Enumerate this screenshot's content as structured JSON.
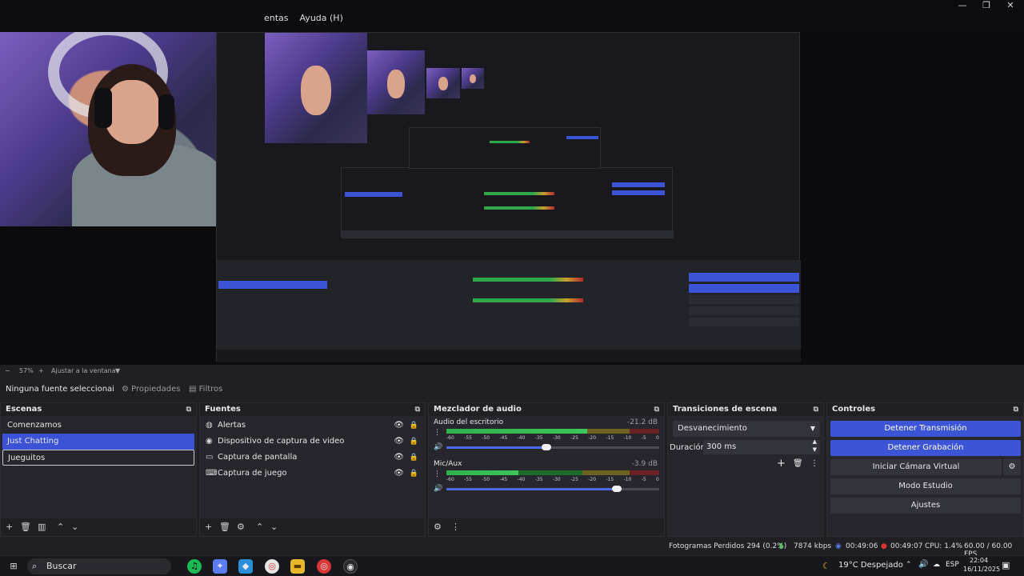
{
  "menu": {
    "items": [
      "entas",
      "Ayuda (H)"
    ]
  },
  "window": {
    "minimize": "—",
    "restore": "❐",
    "close": "✕"
  },
  "zoom": {
    "minus": "−",
    "percent": "57%",
    "plus": "+",
    "fit": "Ajustar a la ventana",
    "fit_arrow": "▼"
  },
  "source_toolbar": {
    "no_source": "Ninguna fuente seleccionai",
    "properties": "Propiedades",
    "filters": "Filtros"
  },
  "scenes": {
    "title": "Escenas",
    "items": [
      "Comenzamos",
      "Just Chatting",
      "Jueguitos"
    ],
    "selected": "Just Chatting"
  },
  "sources": {
    "title": "Fuentes",
    "items": [
      {
        "label": "Alertas",
        "icon": "globe-icon"
      },
      {
        "label": "Dispositivo de captura de video",
        "icon": "camera-icon"
      },
      {
        "label": "Captura de pantalla",
        "icon": "monitor-icon"
      },
      {
        "label": "Captura de juego",
        "icon": "gamepad-icon"
      }
    ]
  },
  "mixer": {
    "title": "Mezclador de audio",
    "channels": [
      {
        "name": "Audio del escritorio",
        "db": "-21.2 dB",
        "level": 0.66,
        "volume": 0.47
      },
      {
        "name": "Mic/Aux",
        "db": "-3.9 dB",
        "level": 0.34,
        "volume": 0.8
      }
    ],
    "ticks": [
      "-60",
      "-55",
      "-50",
      "-45",
      "-40",
      "-35",
      "-30",
      "-25",
      "-20",
      "-15",
      "-10",
      "-5",
      "0"
    ]
  },
  "transitions": {
    "title": "Transiciones de escena",
    "selected": "Desvanecimiento",
    "duration_label": "Duración",
    "duration_value": "300 ms"
  },
  "controls": {
    "title": "Controles",
    "stop_stream": "Detener Transmisión",
    "stop_recording": "Detener Grabación",
    "virtual_cam": "Iniciar Cámara Virtual",
    "studio_mode": "Modo Estudio",
    "settings": "Ajustes"
  },
  "status": {
    "dropped_frames": "Fotogramas Perdidos 294 (0.2%)",
    "bitrate": "7874 kbps",
    "stream_time": "00:49:06",
    "rec_time": "00:49:07",
    "cpu": "CPU: 1.4%",
    "fps": "60.00 / 60.00 FPS"
  },
  "taskbar": {
    "search_placeholder": "Buscar",
    "weather": "19°C  Despejado",
    "lang": "ESP",
    "time": "22:04",
    "date": "16/11/2025"
  },
  "colors": {
    "accent": "#3d54d6",
    "dock_bg": "#26262c",
    "panel_bg": "#1f1f24"
  }
}
